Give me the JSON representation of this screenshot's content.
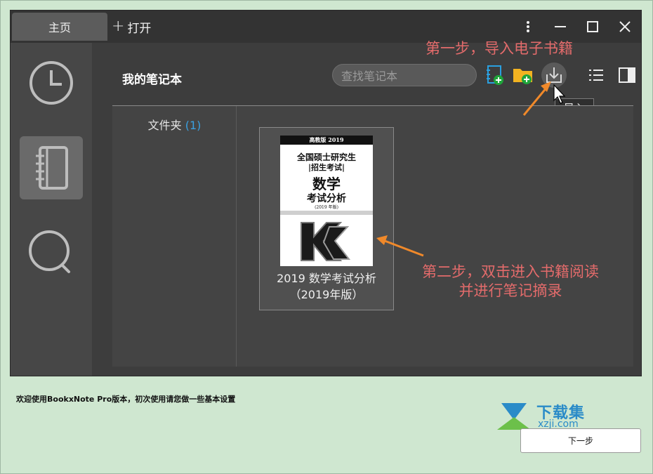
{
  "titlebar": {
    "tab_home": "主页",
    "tab_open": "打开"
  },
  "header": {
    "title": "我的笔记本",
    "search_placeholder": "查找笔记本",
    "tooltip_import": "导入"
  },
  "folders": {
    "label": "文件夹",
    "count": "(1)"
  },
  "book": {
    "cover_top": "高教版 2019",
    "cover_line1": "全国硕士研究生",
    "cover_line2": "|招生考试|",
    "cover_line3": "数学",
    "cover_line4": "考试分析",
    "cover_line5": "(2019 年版)",
    "title_line1": "2019 数学考试分析",
    "title_line2": "（2019年版）"
  },
  "annotations": {
    "step1": "第一步，导入电子书籍",
    "step2_line1": "第二步，双击进入书籍阅读",
    "step2_line2": "并进行笔记摘录"
  },
  "footer": {
    "welcome": "欢迎使用BookxNote Pro版本，初次使用请您做一些基本设置",
    "next_button": "下一步"
  },
  "watermark": {
    "text": "下载集",
    "url": "xzji.com"
  },
  "colors": {
    "annotation": "#e36b6b",
    "arrow": "#f0892a",
    "folder_count": "#3aa0e0",
    "background": "#cfe7d0"
  },
  "icons": {
    "sidebar": [
      "clock-icon",
      "notebook-icon",
      "search-icon"
    ],
    "toolbar": [
      "new-notebook-icon",
      "new-folder-icon",
      "import-icon",
      "list-view-icon",
      "panel-toggle-icon"
    ],
    "window": [
      "more-icon",
      "minimize-icon",
      "maximize-icon",
      "close-icon"
    ]
  }
}
